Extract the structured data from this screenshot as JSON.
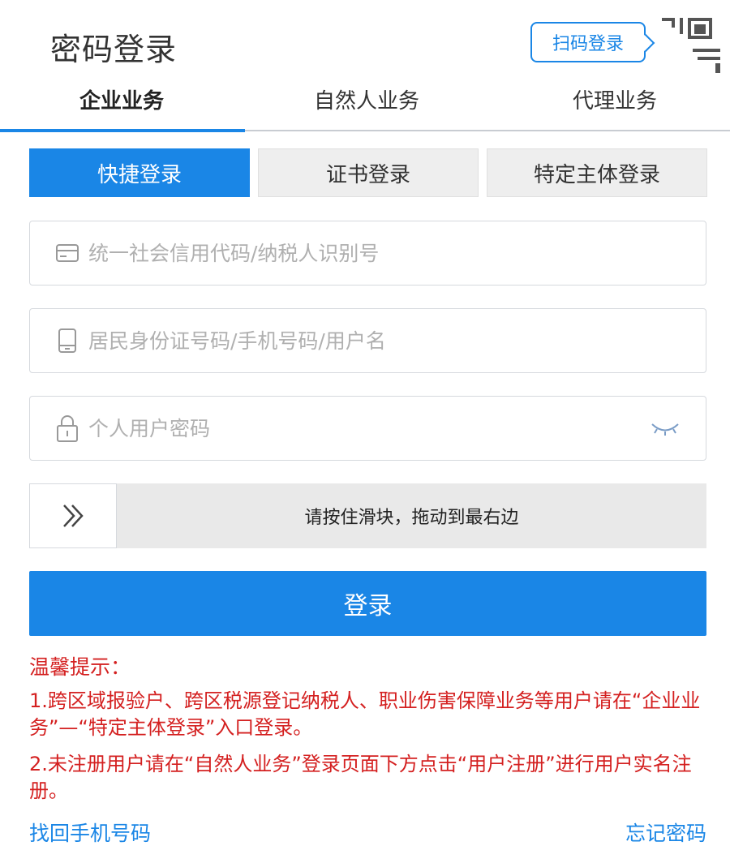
{
  "header": {
    "title": "密码登录",
    "scan_login_label": "扫码登录"
  },
  "tabs": [
    {
      "label": "企业业务",
      "active": true
    },
    {
      "label": "自然人业务",
      "active": false
    },
    {
      "label": "代理业务",
      "active": false
    }
  ],
  "subtabs": [
    {
      "label": "快捷登录",
      "active": true
    },
    {
      "label": "证书登录",
      "active": false
    },
    {
      "label": "特定主体登录",
      "active": false
    }
  ],
  "form": {
    "credit_code_placeholder": "统一社会信用代码/纳税人识别号",
    "credit_code_value": "",
    "account_placeholder": "居民身份证号码/手机号码/用户名",
    "account_value": "",
    "password_placeholder": "个人用户密码",
    "password_value": "",
    "slider_text": "请按住滑块，拖动到最右边",
    "slider_progress": 0,
    "login_label": "登录"
  },
  "tips": {
    "title": "温馨提示：",
    "items": [
      "1.跨区域报验户、跨区税源登记纳税人、职业伤害保障业务等用户请在“企业业务”—“特定主体登录”入口登录。",
      "2.未注册用户请在“自然人业务”登录页面下方点击“用户注册”进行用户实名注册。"
    ]
  },
  "footer": {
    "retrieve_phone_label": "找回手机号码",
    "forgot_password_label": "忘记密码"
  },
  "colors": {
    "accent": "#1a86e6",
    "warning_text": "#d42020",
    "subtab_inactive_bg": "#eeeeee",
    "slider_track_bg": "#e9e9e9"
  },
  "icons": {
    "credit_code_field": "card-icon",
    "account_field": "phone-icon",
    "password_field": "lock-icon",
    "password_toggle": "eye-closed-icon",
    "slider_handle": "double-chevron-right-icon",
    "corner": "qr-code-icon"
  }
}
